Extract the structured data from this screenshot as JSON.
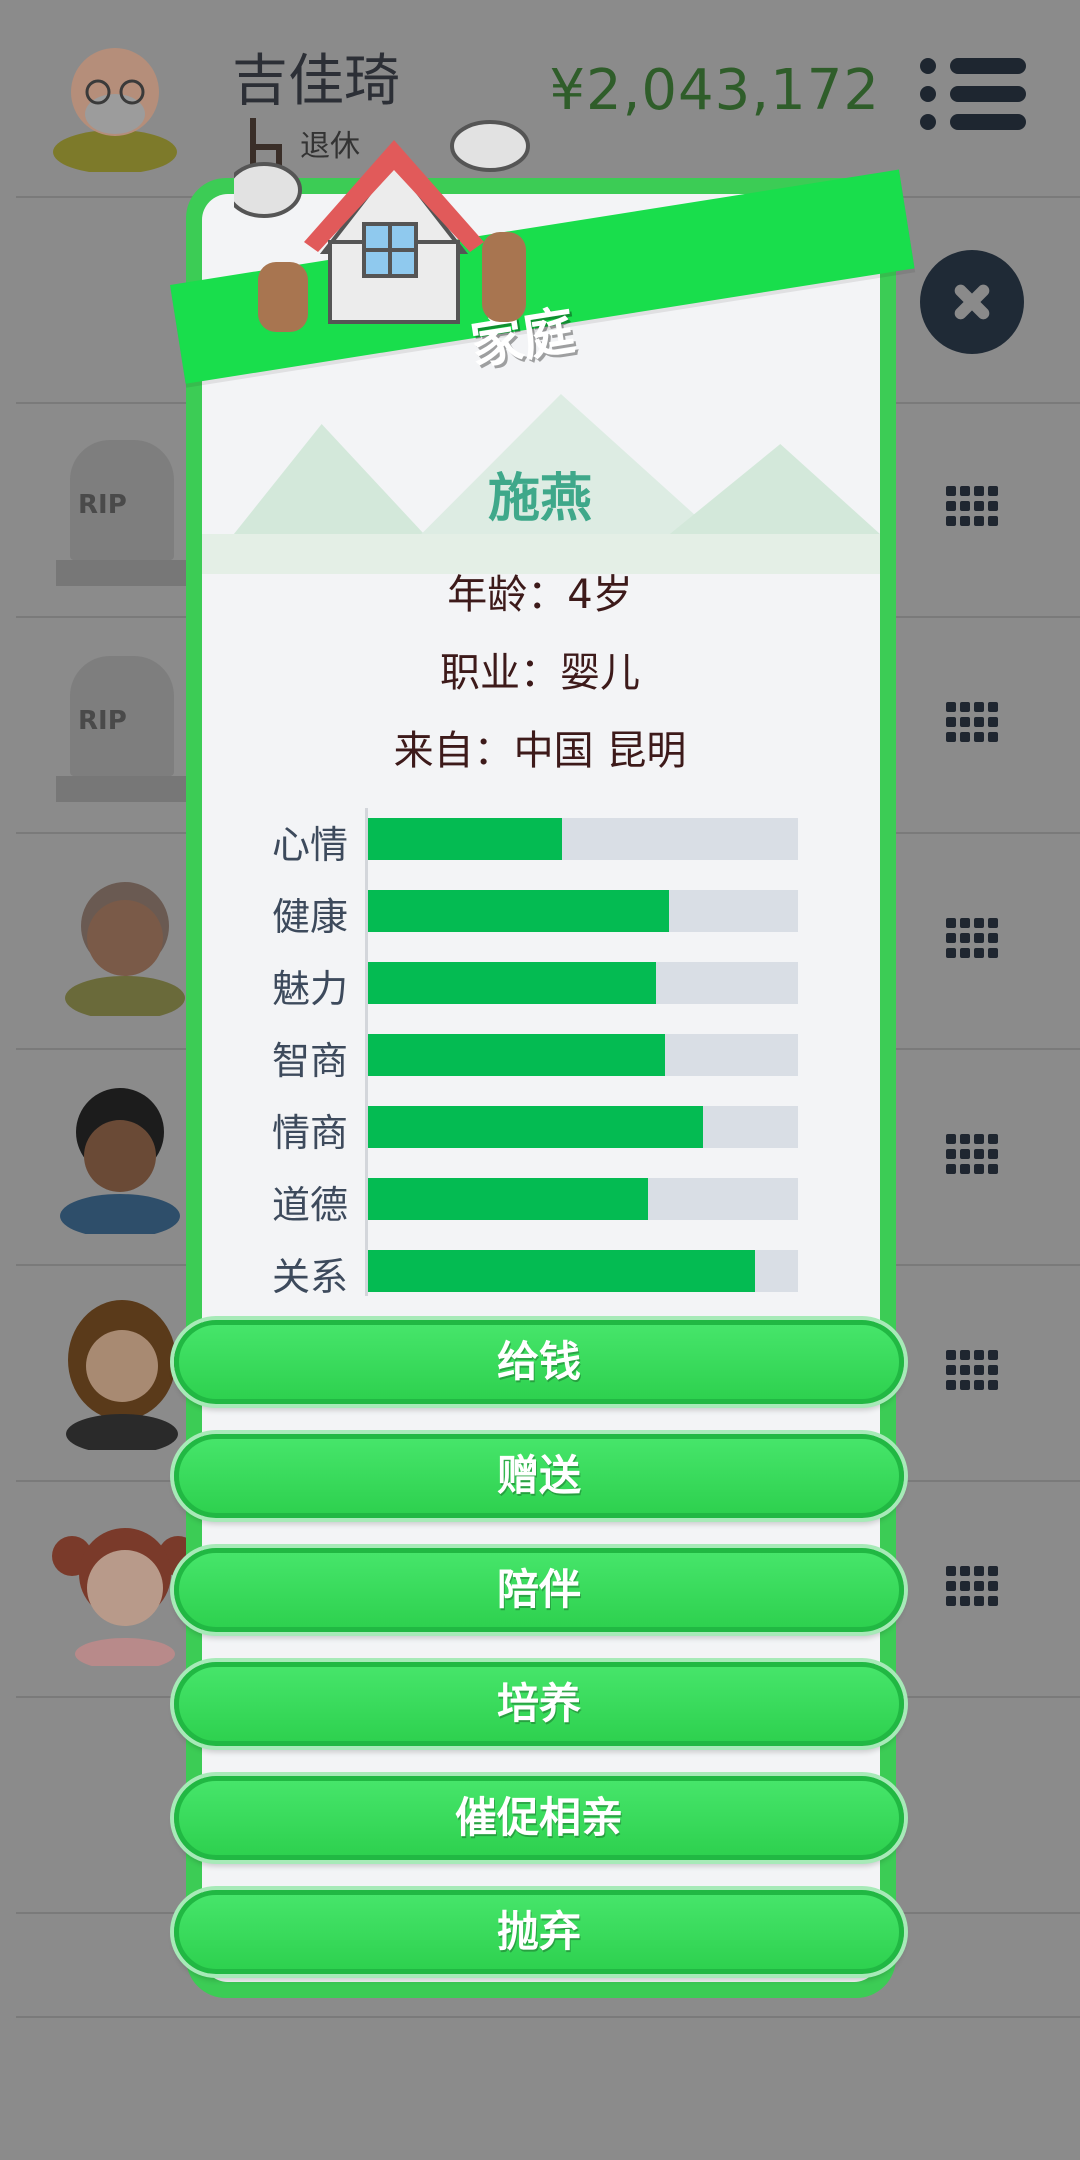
{
  "header": {
    "name": "吉佳琦",
    "status_text": "退休",
    "money": "¥2,043,172"
  },
  "modal": {
    "title": "家庭",
    "person": {
      "name": "施燕",
      "age_line": "年龄：4岁",
      "job_line": "职业：婴儿",
      "from_line": "来自：中国 昆明"
    },
    "stats": [
      {
        "label": "心情",
        "value": 0.45
      },
      {
        "label": "健康",
        "value": 0.7
      },
      {
        "label": "魅力",
        "value": 0.67
      },
      {
        "label": "智商",
        "value": 0.69
      },
      {
        "label": "情商",
        "value": 0.78
      },
      {
        "label": "道德",
        "value": 0.65
      },
      {
        "label": "关系",
        "value": 0.9
      }
    ],
    "actions": [
      {
        "label": "给钱"
      },
      {
        "label": "赠送"
      },
      {
        "label": "陪伴"
      },
      {
        "label": "培养"
      },
      {
        "label": "催促相亲"
      },
      {
        "label": "抛弃"
      }
    ]
  },
  "background_rows": [
    {
      "avatar": "grandpa-avatar"
    },
    {
      "avatar": "empty"
    },
    {
      "avatar": "tombstone-icon",
      "text": "RIP"
    },
    {
      "avatar": "tombstone-icon",
      "text": "RIP"
    },
    {
      "avatar": "elderly-man-avatar"
    },
    {
      "avatar": "curly-hair-man-avatar"
    },
    {
      "avatar": "woman-avatar"
    },
    {
      "avatar": "girl-avatar"
    }
  ],
  "colors": {
    "accent_green": "#19de4c",
    "stat_fill": "#04bb52",
    "name_color": "#3fa88a",
    "money_color": "#2f5d2a"
  }
}
